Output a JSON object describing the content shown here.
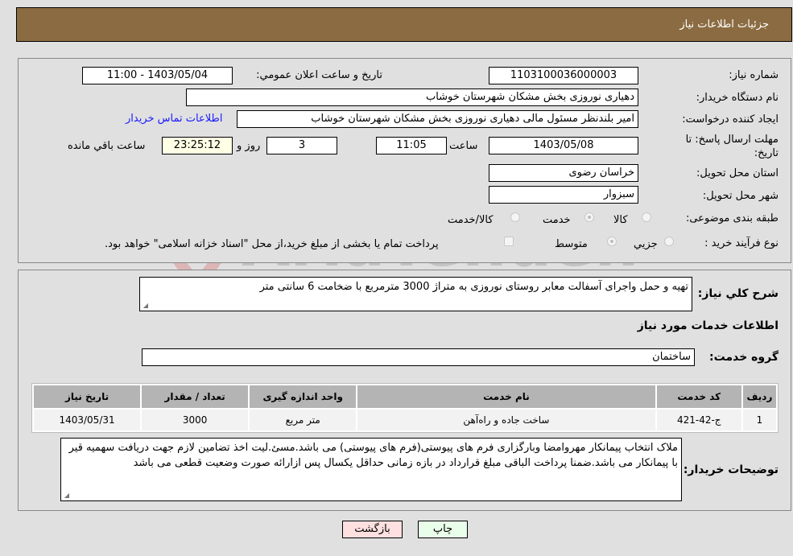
{
  "header": {
    "title": "جزئیات اطلاعات نیاز"
  },
  "form": {
    "need_number": {
      "label": "شماره نیاز:",
      "value": "1103100036000003"
    },
    "announce_datetime": {
      "label": "تاریخ و ساعت اعلان عمومي:",
      "value": "1403/05/04 - 11:00"
    },
    "buyer_org": {
      "label": "نام دستگاه خریدار:",
      "value": "دهیاری نوروزی بخش مشکان شهرستان خوشاب"
    },
    "requester": {
      "label": "ایجاد کننده درخواست:",
      "value": "امیر بلندنظر مسئول مالی دهیاری نوروزی بخش مشکان شهرستان خوشاب"
    },
    "buyer_contact_link": "اطلاعات تماس خریدار",
    "deadline": {
      "label": "مهلت ارسال پاسخ: تا تاریخ:",
      "date": "1403/05/08",
      "time_label": "ساعت",
      "time": "11:05",
      "days": "3",
      "days_label": "روز و",
      "remaining": "23:25:12",
      "remaining_label": "ساعت باقي مانده"
    },
    "province": {
      "label": "استان محل تحویل:",
      "value": "خراسان رضوی"
    },
    "city": {
      "label": "شهر محل تحویل:",
      "value": "سبزوار"
    },
    "category": {
      "label": "طبقه بندی موضوعی:",
      "options": [
        "کالا",
        "خدمت",
        "کالا/خدمت"
      ],
      "selected": "خدمت"
    },
    "purchase_type": {
      "label": "نوع فرآیند خرید :",
      "options": [
        "جزيي",
        "متوسط"
      ],
      "selected": "متوسط",
      "treasury_note": "پرداخت تمام یا بخشی از مبلغ خرید،از محل \"اسناد خزانه اسلامی\" خواهد بود."
    }
  },
  "summary": {
    "label": "شرح کلي نياز:",
    "value": "تهیه و حمل واجرای آسفالت معابر روستای نوروزی به متراژ 3000 مترمربع با ضخامت 6 سانتی متر"
  },
  "services_section": {
    "title": "اطلاعات خدمات مورد نیاز",
    "group_label": "گروه خدمت:",
    "group_value": "ساختمان",
    "table": {
      "headers": [
        "ردیف",
        "کد خدمت",
        "نام خدمت",
        "واحد اندازه گیری",
        "تعداد / مقدار",
        "تاریخ نیاز"
      ],
      "rows": [
        [
          "1",
          "ج-42-421",
          "ساخت جاده و راه‌آهن",
          "متر مربع",
          "3000",
          "1403/05/31"
        ]
      ]
    }
  },
  "buyer_notes": {
    "label": "توضیحات خریدار:",
    "value": "ملاک انتخاب پیمانکار مهروامضا وبارگزاری فرم های پیوستی(فرم های پیوستی) می باشد.مسئ.لیت اخذ تضامین لازم جهت دریافت سهمیه قیر با پیمانکار می باشد.ضمنا پرداخت الباقی مبلغ قرارداد در بازه زمانی حداقل یکسال پس ازارائه صورت وضعیت قطعی می باشد"
  },
  "buttons": {
    "print": "چاپ",
    "back": "بازگشت"
  },
  "watermark": {
    "text": "AriaTender.neT"
  }
}
